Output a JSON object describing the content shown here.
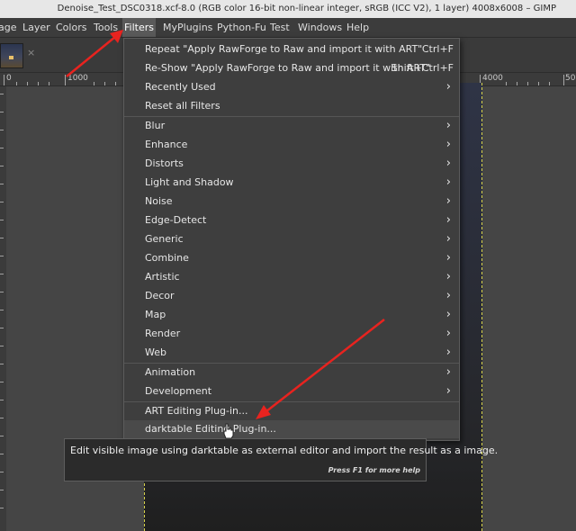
{
  "window": {
    "title": "Denoise_Test_DSC0318.xcf-8.0 (RGB color 16-bit non-linear integer, sRGB (ICC V2), 1 layer) 4008x6008 – GIMP"
  },
  "menubar": [
    {
      "label": "age",
      "name": "menu-image"
    },
    {
      "label": "Layer",
      "name": "menu-layer"
    },
    {
      "label": "Colors",
      "name": "menu-colors"
    },
    {
      "label": "Tools",
      "name": "menu-tools"
    },
    {
      "label": "Filters",
      "name": "menu-filters",
      "active": true
    },
    {
      "label": "MyPlugins",
      "name": "menu-myplugins"
    },
    {
      "label": "Python-Fu",
      "name": "menu-python-fu"
    },
    {
      "label": "Test",
      "name": "menu-test"
    },
    {
      "label": "Windows",
      "name": "menu-windows"
    },
    {
      "label": "Help",
      "name": "menu-help"
    }
  ],
  "tab": {
    "close": "×"
  },
  "ruler": {
    "labels": [
      "0",
      "1000",
      "4000",
      "50"
    ]
  },
  "filters_menu": {
    "items": [
      {
        "label": "Repeat \"Apply RawForge to Raw and import it with ART\"",
        "shortcut": "Ctrl+F"
      },
      {
        "label": "Re-Show \"Apply RawForge to Raw and import it with ART\"",
        "shortcut": "Shift+Ctrl+F"
      },
      {
        "label": "Recently Used",
        "submenu": true
      },
      {
        "label": "Reset all Filters"
      },
      {
        "label": "Blur",
        "submenu": true
      },
      {
        "label": "Enhance",
        "submenu": true
      },
      {
        "label": "Distorts",
        "submenu": true
      },
      {
        "label": "Light and Shadow",
        "submenu": true
      },
      {
        "label": "Noise",
        "submenu": true
      },
      {
        "label": "Edge-Detect",
        "submenu": true
      },
      {
        "label": "Generic",
        "submenu": true
      },
      {
        "label": "Combine",
        "submenu": true
      },
      {
        "label": "Artistic",
        "submenu": true
      },
      {
        "label": "Decor",
        "submenu": true
      },
      {
        "label": "Map",
        "submenu": true
      },
      {
        "label": "Render",
        "submenu": true
      },
      {
        "label": "Web",
        "submenu": true
      },
      {
        "label": "Animation",
        "submenu": true
      },
      {
        "label": "Development",
        "submenu": true
      },
      {
        "label": "ART Editing Plug-in..."
      },
      {
        "label": "darktable Editing Plug-in...",
        "highlighted": true
      }
    ],
    "arrow_glyph": "›"
  },
  "tooltip": {
    "text": "Edit visible image using darktable as external editor and import the result as a image.",
    "help": "Press F1 for more help"
  },
  "colors": {
    "menu_bg": "#3e3e3e",
    "annotation_arrow": "#e8231f",
    "canvas_bg": "#454545",
    "titlebar_bg": "#e7e7e7"
  }
}
